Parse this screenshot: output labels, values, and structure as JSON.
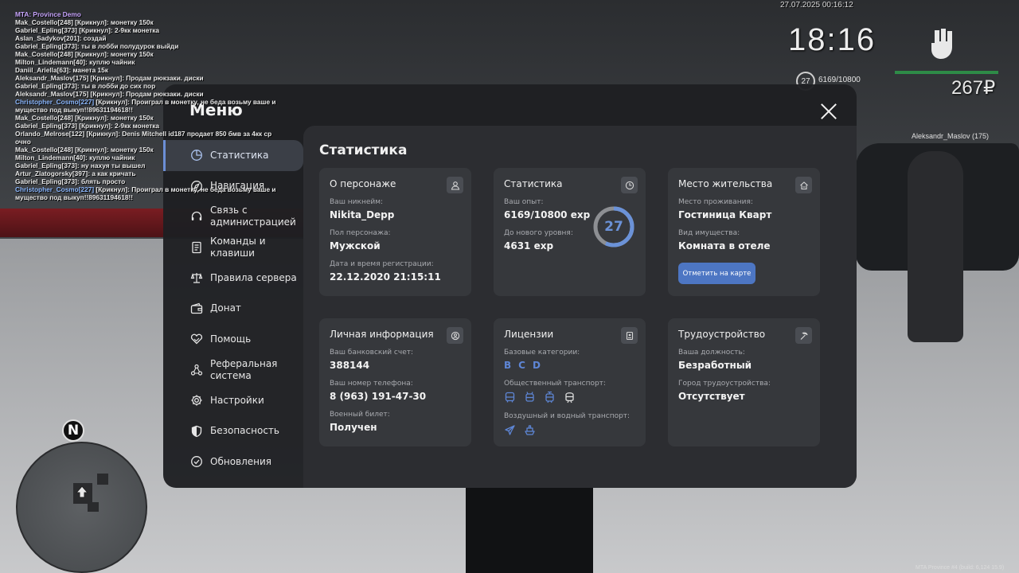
{
  "chat": {
    "header": "MTA: Province Demo",
    "lines": [
      {
        "nick": "Mak_Costello[248]",
        "text": " [Крикнул]: монетку 150к",
        "blue": false
      },
      {
        "nick": "Gabriel_Epling[373]",
        "text": " [Крикнул]: 2-9кк монетка",
        "blue": false
      },
      {
        "nick": "Aslan_Sadykov[201]",
        "text": ": создай",
        "blue": false
      },
      {
        "nick": "Gabriel_Epling[373]",
        "text": ": ты в лобби полудурок выйди",
        "blue": false
      },
      {
        "nick": "Mak_Costello[248]",
        "text": " [Крикнул]: монетку 150к",
        "blue": false
      },
      {
        "nick": "Milton_Lindemann[40]",
        "text": ": куплю чайник",
        "blue": false
      },
      {
        "nick": "Daniil_Ariella[63]",
        "text": ": манета 15к",
        "blue": false
      },
      {
        "nick": "Aleksandr_Maslov[175]",
        "text": " [Крикнул]: Продам рюкзаки. диски",
        "blue": false
      },
      {
        "nick": "Gabriel_Epling[373]",
        "text": ": ты в лобби до сих пор",
        "blue": false
      },
      {
        "nick": "Aleksandr_Maslov[175]",
        "text": " [Крикнул]: Продам рюкзаки. диски",
        "blue": false
      },
      {
        "nick": "Christopher_Cosmo[227]",
        "text": " [Крикнул]: Проиграл в монетку, не беда возьму ваше и",
        "blue": true
      },
      {
        "nick": "",
        "text": "мущество под выкуп!!89631194618!!",
        "blue": false
      },
      {
        "nick": "Mak_Costello[248]",
        "text": " [Крикнул]: монетку 150к",
        "blue": false
      },
      {
        "nick": "Gabriel_Epling[373]",
        "text": " [Крикнул]: 2-9кк монетка",
        "blue": false
      },
      {
        "nick": "Orlando_Melrose[122]",
        "text": " [Крикнул]: Denis Mitchell id187 продает 850 бмв за 4кк ср",
        "blue": false
      },
      {
        "nick": "",
        "text": "очно",
        "blue": false
      },
      {
        "nick": "Mak_Costello[248]",
        "text": " [Крикнул]: монетку 150к",
        "blue": false
      },
      {
        "nick": "Milton_Lindemann[40]",
        "text": ": куплю чайник",
        "blue": false
      },
      {
        "nick": "Gabriel_Epling[373]",
        "text": ": ну нахуя ты вышел",
        "blue": false
      },
      {
        "nick": "Artur_Zlatogorsky[397]",
        "text": ": а как кричать",
        "blue": false
      },
      {
        "nick": "Gabriel_Epling[373]",
        "text": ": блять просто",
        "blue": false
      },
      {
        "nick": "Christopher_Cosmo[227]",
        "text": " [Крикнул]: Проиграл в монетку, не беда возьму ваше и",
        "blue": true
      },
      {
        "nick": "",
        "text": "мущество под выкуп!!89631194618!!",
        "blue": false
      }
    ]
  },
  "hud": {
    "datetime": "27.07.2025 00:16:12",
    "clock": "18:16",
    "level": "27",
    "exp": "6169/10800",
    "money": "267₽",
    "nametag": "Aleksandr_Maslov (175)",
    "build": "MTA Province #4 (build: 6,124 15.9)",
    "colors": {
      "health": "#2e8b47"
    }
  },
  "radar": {
    "north": "N"
  },
  "menu": {
    "title": "Меню",
    "sidebar": [
      {
        "label": "Статистика",
        "icon": "pie-chart-icon",
        "active": true
      },
      {
        "label": "Навигация",
        "icon": "compass-icon",
        "active": false
      },
      {
        "label": "Связь с администрацией",
        "icon": "headset-icon",
        "active": false
      },
      {
        "label": "Команды и клавиши",
        "icon": "document-icon",
        "active": false
      },
      {
        "label": "Правила сервера",
        "icon": "scales-icon",
        "active": false
      },
      {
        "label": "Донат",
        "icon": "wallet-icon",
        "active": false
      },
      {
        "label": "Помощь",
        "icon": "heart-hand-icon",
        "active": false
      },
      {
        "label": "Реферальная система",
        "icon": "network-icon",
        "active": false
      },
      {
        "label": "Настройки",
        "icon": "gear-icon",
        "active": false
      },
      {
        "label": "Безопасность",
        "icon": "shield-icon",
        "active": false
      },
      {
        "label": "Обновления",
        "icon": "check-circle-icon",
        "active": false
      }
    ],
    "content_title": "Статистика",
    "cards": {
      "character": {
        "title": "О персонаже",
        "nickname_label": "Ваш никнейм:",
        "nickname": "Nikita_Depp",
        "gender_label": "Пол персонажа:",
        "gender": "Мужской",
        "reg_label": "Дата и время регистрации:",
        "reg": "22.12.2020 21:15:11"
      },
      "stats": {
        "title": "Статистика",
        "exp_label": "Ваш опыт:",
        "exp": "6169/10800 exp",
        "next_label": "До нового уровня:",
        "next": "4631 exp",
        "level": "27",
        "progress": 0.571
      },
      "residence": {
        "title": "Место жительства",
        "place_label": "Место проживания:",
        "place": "Гостиница Кварт",
        "property_label": "Вид имущества:",
        "property": "Комната в отеле",
        "button": "Отметить на карте"
      },
      "personal": {
        "title": "Личная информация",
        "bank_label": "Ваш банковский счет:",
        "bank": "388144",
        "phone_label": "Ваш номер телефона:",
        "phone": "8 (963) 191-47-30",
        "military_label": "Военный билет:",
        "military": "Получен"
      },
      "licenses": {
        "title": "Лицензии",
        "basic_label": "Базовые категории:",
        "basic": [
          "B",
          "C",
          "D"
        ],
        "public_label": "Общественный транспорт:",
        "public_icons": [
          "bus-icon",
          "trolleybus-icon",
          "tram-icon",
          "metro-icon"
        ],
        "air_label": "Воздушный и водный транспорт:",
        "air_icons": [
          "plane-icon",
          "boat-icon"
        ]
      },
      "employment": {
        "title": "Трудоустройство",
        "position_label": "Ваша должность:",
        "position": "Безработный",
        "org_label": "Город трудоустройства:",
        "org": "Отсутствует"
      }
    },
    "colors": {
      "accent": "#4d76c3",
      "license": "#5e86d6",
      "ring": "#6b92d8"
    }
  }
}
